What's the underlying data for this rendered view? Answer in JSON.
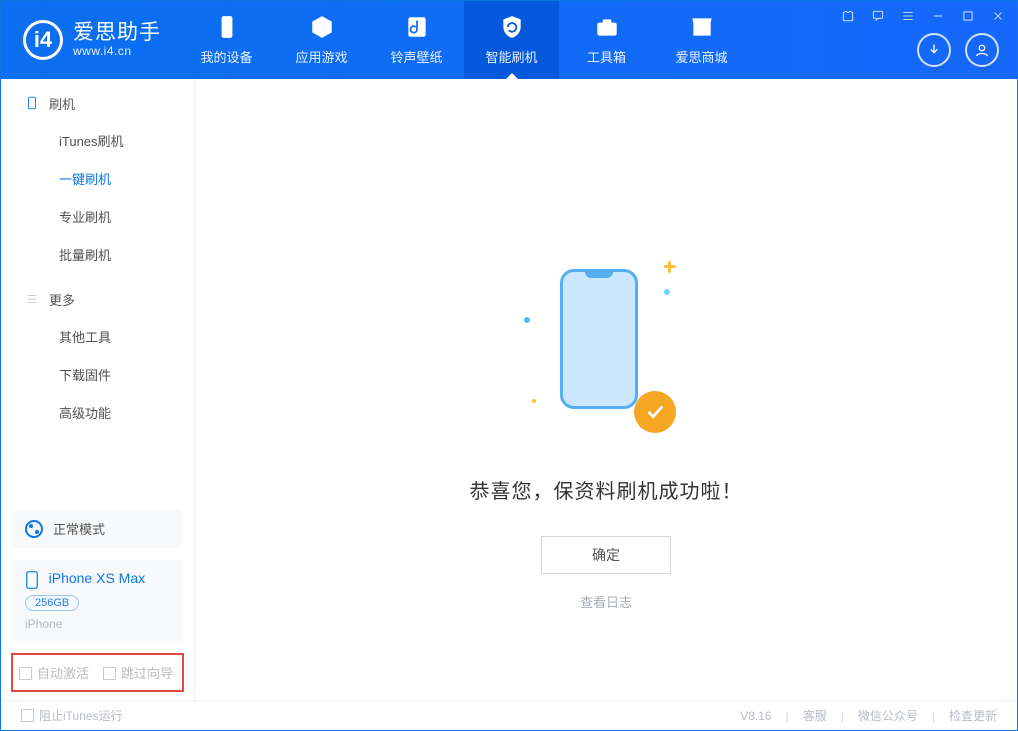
{
  "app": {
    "title": "爱思助手",
    "subtitle": "www.i4.cn"
  },
  "nav": {
    "tabs": [
      "我的设备",
      "应用游戏",
      "铃声壁纸",
      "智能刷机",
      "工具箱",
      "爱思商城"
    ],
    "active_index": 3
  },
  "sidebar": {
    "section_flash": "刷机",
    "items_flash": [
      "iTunes刷机",
      "一键刷机",
      "专业刷机",
      "批量刷机"
    ],
    "active_flash_index": 1,
    "section_more": "更多",
    "items_more": [
      "其他工具",
      "下载固件",
      "高级功能"
    ],
    "mode_label": "正常模式",
    "device_name": "iPhone XS Max",
    "device_storage": "256GB",
    "device_type": "iPhone",
    "chk_auto_activate": "自动激活",
    "chk_skip_guide": "跳过向导"
  },
  "main": {
    "success_message": "恭喜您，保资料刷机成功啦！",
    "ok_button": "确定",
    "view_log": "查看日志"
  },
  "statusbar": {
    "block_itunes": "阻止iTunes运行",
    "version": "V8.16",
    "cs": "客服",
    "wechat": "微信公众号",
    "update": "检查更新"
  }
}
